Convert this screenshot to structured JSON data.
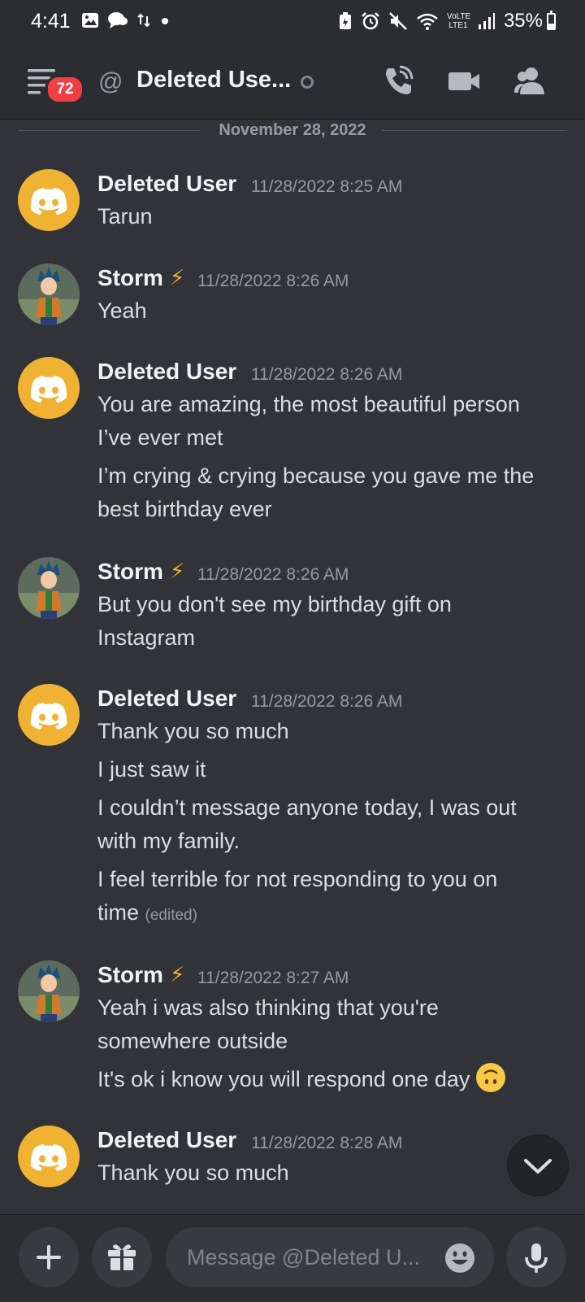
{
  "status_bar": {
    "time": "4:41",
    "network": "VoLTE LTE1",
    "battery_text": "35%",
    "battery_level": 0.35
  },
  "header": {
    "unread_badge": "72",
    "title": "Deleted Use...",
    "icons": [
      "menu-icon",
      "at-icon",
      "voice-call-icon",
      "video-call-icon",
      "members-icon"
    ]
  },
  "date_divider": "November 28, 2022",
  "messages": [
    {
      "author": "Deleted User",
      "timestamp": "11/28/2022 8:25 AM",
      "lines": [
        "Tarun"
      ]
    },
    {
      "author": "Storm",
      "timestamp": "11/28/2022 8:26 AM",
      "lines": [
        "Yeah"
      ]
    },
    {
      "author": "Deleted User",
      "timestamp": "11/28/2022 8:26 AM",
      "lines": [
        "You are amazing, the most beautiful person",
        "I’ve ever met",
        "I’m crying & crying because you gave me the",
        "best birthday ever"
      ]
    },
    {
      "author": "Storm",
      "timestamp": "11/28/2022 8:26 AM",
      "lines": [
        "But you don't see my birthday gift on",
        "Instagram"
      ]
    },
    {
      "author": "Deleted User",
      "timestamp": "11/28/2022 8:26 AM",
      "lines": [
        "Thank you so much",
        "I just saw it",
        "I couldn’t message anyone today, I was out",
        "with my family.",
        "I feel terrible for not responding to you on",
        "time"
      ],
      "edited": "(edited)"
    },
    {
      "author": "Storm",
      "timestamp": "11/28/2022 8:27 AM",
      "lines": [
        "Yeah i was also thinking that you're",
        "somewhere outside",
        "It's ok i know you will respond one day"
      ]
    },
    {
      "author": "Deleted User",
      "timestamp": "11/28/2022 8:28 AM",
      "lines": [
        "Thank you so much"
      ]
    }
  ],
  "composer": {
    "placeholder": "Message @Deleted U...",
    "icons": [
      "plus-icon",
      "gift-icon",
      "emoji-icon",
      "microphone-icon"
    ]
  },
  "colors": {
    "background": "#313338",
    "header": "#2b2d31",
    "discord_avatar": "#f0b232",
    "badge": "#f23f43"
  }
}
